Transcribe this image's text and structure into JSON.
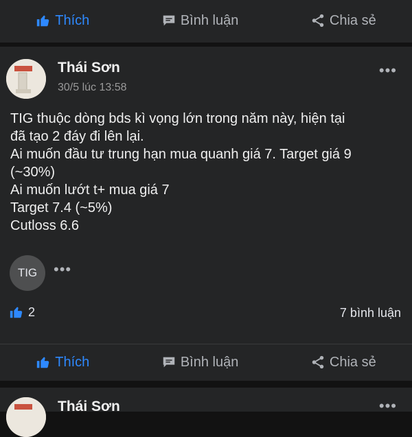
{
  "actions": {
    "like": "Thích",
    "comment": "Bình luận",
    "share": "Chia sẻ"
  },
  "post": {
    "author": "Thái Sơn",
    "time": "30/5 lúc 13:58",
    "more": "•••",
    "lines": [
      "TIG thuộc dòng bds kì vọng lớn trong năm này, hiện tại",
      "đã tạo 2 đáy đi lên lại.",
      "Ai muốn đầu tư trung hạn mua quanh giá 7. Target giá 9",
      "(~30%)",
      "Ai muốn lướt t+ mua giá 7",
      "Target 7.4 (~5%)",
      "Cutloss 6.6"
    ],
    "tag": "TIG",
    "tag_more": "•••",
    "like_count": "2",
    "comment_count": "7 bình luận"
  },
  "next_post": {
    "author": "Thái Sơn",
    "more": "•••"
  },
  "colors": {
    "accent": "#2e89ff",
    "background": "#121212",
    "card": "#242526"
  },
  "icons": {
    "like": "thumbs-up-icon",
    "comment": "speech-bubble-icon",
    "share": "share-icon"
  }
}
